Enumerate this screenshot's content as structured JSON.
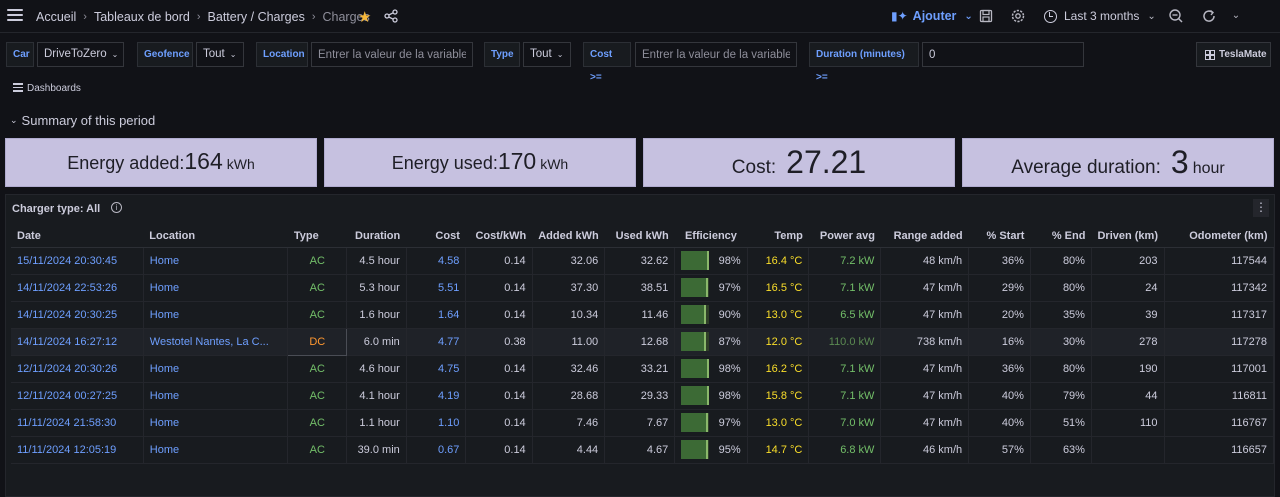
{
  "breadcrumbs": [
    "Accueil",
    "Tableaux de bord",
    "Battery / Charges",
    "Charges"
  ],
  "toolbar": {
    "add_label": "Ajouter",
    "time_range": "Last 3 months"
  },
  "variables": {
    "car_label": "Car",
    "car_value": "DriveToZero",
    "geofence_label": "Geofence",
    "geofence_value": "Tout",
    "location_label": "Location",
    "location_placeholder": "Entrer la valeur de la variable",
    "type_label": "Type",
    "type_value": "Tout",
    "cost_label": "Cost >=",
    "cost_placeholder": "Entrer la valeur de la variable",
    "duration_label": "Duration (minutes) >=",
    "duration_value": "0",
    "teslamate_label": "TeslaMate"
  },
  "dashboards_link": "Dashboards",
  "row_title": "Summary of this period",
  "stats": {
    "energy_added": {
      "label": "Energy added:",
      "value": "164",
      "unit": "kWh"
    },
    "energy_used": {
      "label": "Energy used:",
      "value": "170",
      "unit": "kWh"
    },
    "cost": {
      "label": "Cost:",
      "value": "27.21"
    },
    "avg_duration": {
      "label": "Average duration:",
      "value": "3",
      "unit": "hour"
    }
  },
  "panel": {
    "title": "Charger type: All",
    "info_icon": "i",
    "menu_icon": "⋮"
  },
  "table": {
    "headers": [
      "Date",
      "Location",
      "Type",
      "Duration",
      "Cost",
      "Cost/kWh",
      "Added kWh",
      "Used kWh",
      "Efficiency",
      "Temp",
      "Power avg",
      "Range added",
      "% Start",
      "% End",
      "Driven (km)",
      "Odometer (km)"
    ],
    "rows": [
      {
        "date": "15/11/2024 20:30:45",
        "location": "Home",
        "type": "AC",
        "duration": "4.5 hour",
        "cost": "4.58",
        "cost_kwh": "0.14",
        "added": "32.06",
        "used": "32.62",
        "eff": "98%",
        "eff_frac": 0.98,
        "temp": "16.4 °C",
        "power": "7.2 kW",
        "range": "48 km/h",
        "start": "36%",
        "end": "80%",
        "driven": "203",
        "odo": "117544"
      },
      {
        "date": "14/11/2024 22:53:26",
        "location": "Home",
        "type": "AC",
        "duration": "5.3 hour",
        "cost": "5.51",
        "cost_kwh": "0.14",
        "added": "37.30",
        "used": "38.51",
        "eff": "97%",
        "eff_frac": 0.97,
        "temp": "16.5 °C",
        "power": "7.1 kW",
        "range": "47 km/h",
        "start": "29%",
        "end": "80%",
        "driven": "24",
        "odo": "117342"
      },
      {
        "date": "14/11/2024 20:30:25",
        "location": "Home",
        "type": "AC",
        "duration": "1.6 hour",
        "cost": "1.64",
        "cost_kwh": "0.14",
        "added": "10.34",
        "used": "11.46",
        "eff": "90%",
        "eff_frac": 0.9,
        "temp": "13.0 °C",
        "power": "6.5 kW",
        "range": "47 km/h",
        "start": "20%",
        "end": "35%",
        "driven": "39",
        "odo": "117317"
      },
      {
        "date": "14/11/2024 16:27:12",
        "location": "Westotel Nantes, La C...",
        "type": "DC",
        "duration": "6.0 min",
        "cost": "4.77",
        "cost_kwh": "0.38",
        "added": "11.00",
        "used": "12.68",
        "eff": "87%",
        "eff_frac": 0.87,
        "temp": "12.0 °C",
        "power": "110.0 kW",
        "range": "738 km/h",
        "start": "16%",
        "end": "30%",
        "driven": "278",
        "odo": "117278"
      },
      {
        "date": "12/11/2024 20:30:26",
        "location": "Home",
        "type": "AC",
        "duration": "4.6 hour",
        "cost": "4.75",
        "cost_kwh": "0.14",
        "added": "32.46",
        "used": "33.21",
        "eff": "98%",
        "eff_frac": 0.98,
        "temp": "16.2 °C",
        "power": "7.1 kW",
        "range": "47 km/h",
        "start": "36%",
        "end": "80%",
        "driven": "190",
        "odo": "117001"
      },
      {
        "date": "12/11/2024 00:27:25",
        "location": "Home",
        "type": "AC",
        "duration": "4.1 hour",
        "cost": "4.19",
        "cost_kwh": "0.14",
        "added": "28.68",
        "used": "29.33",
        "eff": "98%",
        "eff_frac": 0.98,
        "temp": "15.8 °C",
        "power": "7.1 kW",
        "range": "47 km/h",
        "start": "40%",
        "end": "79%",
        "driven": "44",
        "odo": "116811"
      },
      {
        "date": "11/11/2024 21:58:30",
        "location": "Home",
        "type": "AC",
        "duration": "1.1 hour",
        "cost": "1.10",
        "cost_kwh": "0.14",
        "added": "7.46",
        "used": "7.67",
        "eff": "97%",
        "eff_frac": 0.97,
        "temp": "13.0 °C",
        "power": "7.0 kW",
        "range": "47 km/h",
        "start": "40%",
        "end": "51%",
        "driven": "110",
        "odo": "116767"
      },
      {
        "date": "11/11/2024 12:05:19",
        "location": "Home",
        "type": "AC",
        "duration": "39.0 min",
        "cost": "0.67",
        "cost_kwh": "0.14",
        "added": "4.44",
        "used": "4.67",
        "eff": "95%",
        "eff_frac": 0.95,
        "temp": "14.7 °C",
        "power": "6.8 kW",
        "range": "46 km/h",
        "start": "57%",
        "end": "63%",
        "driven": "",
        "odo": "116657"
      }
    ]
  },
  "colors": {
    "accent": "#6e9fff",
    "star": "#f5b73b",
    "ac": "#73bf69",
    "dc": "#ff9830",
    "temp": "#fade2a",
    "stat_bg": "#c6c1e0"
  }
}
